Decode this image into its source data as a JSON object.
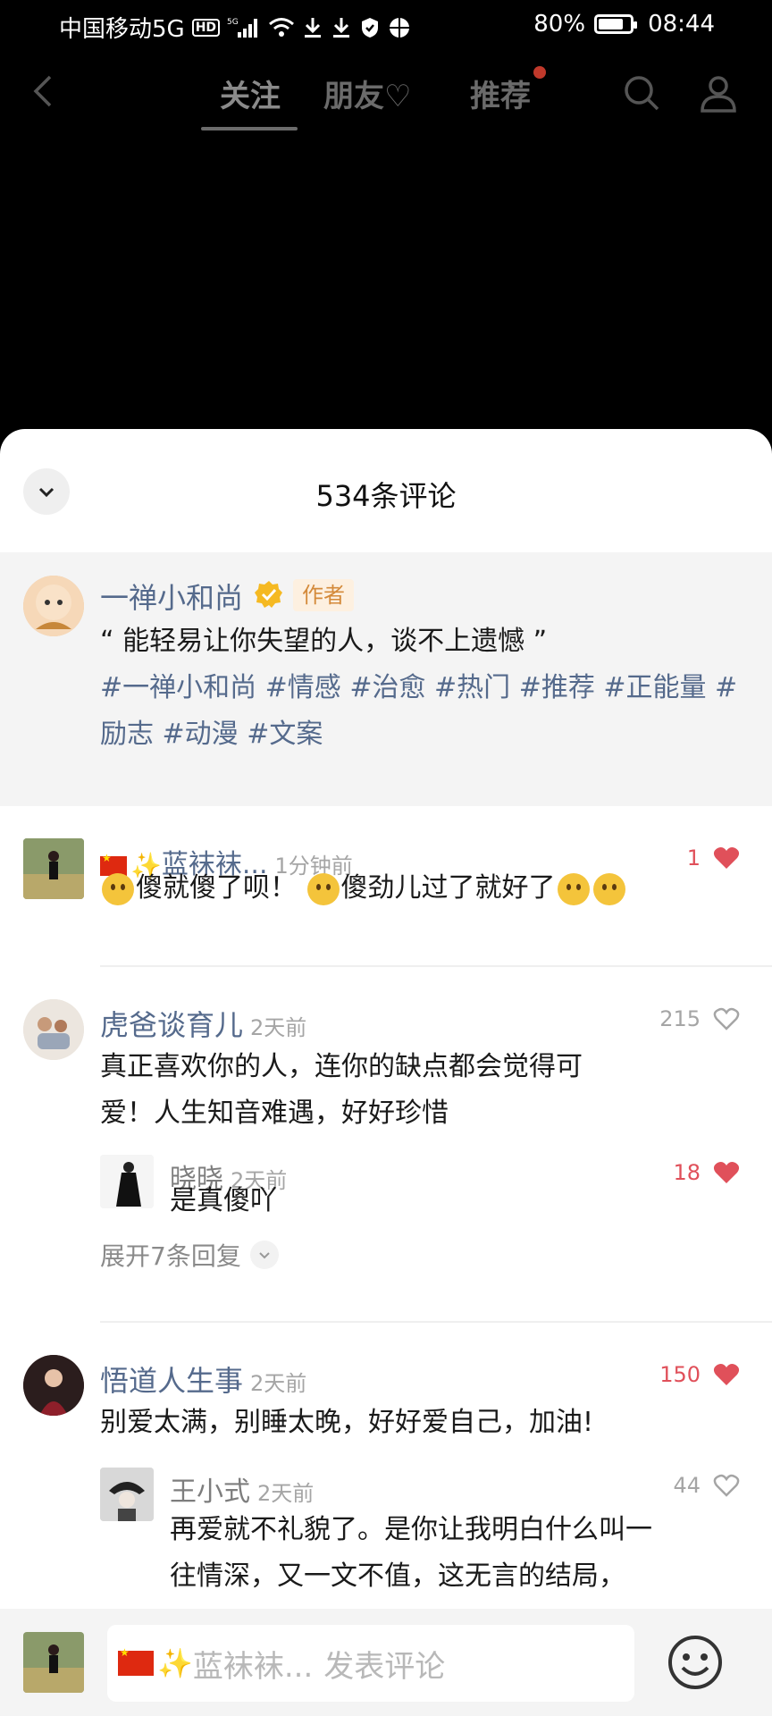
{
  "status_bar": {
    "carrier": "中国移动5G",
    "hd": "HD",
    "network": "5G",
    "battery": "80%",
    "battery_level": 0.8,
    "time": "08:44"
  },
  "top_nav": {
    "tabs": [
      {
        "label": "关注"
      },
      {
        "label": "朋友♡"
      },
      {
        "label": "推荐"
      }
    ]
  },
  "comments_panel": {
    "title": "534条评论",
    "author_post": {
      "name": "一禅小和尚",
      "badge": "作者",
      "text": "“ 能轻易让你失望的人，谈不上遗憾 ”",
      "tags_line1": "#一禅小和尚 #情感 #治愈 #热门 #推荐 #正能量 #",
      "tags_line2": "励志 #动漫 #文案"
    },
    "comments": [
      {
        "name": "蓝袜袜...",
        "time": "1分钟前",
        "likes": "1",
        "text_part1": "傻就傻了呗！",
        "text_part2": "傻劲儿过了就好了"
      },
      {
        "name": "虎爸谈育儿",
        "time": "2天前",
        "likes": "215",
        "text_line1": "真正喜欢你的人，连你的缺点都会觉得可",
        "text_line2": "爱！人生知音难遇，好好珍惜",
        "reply": {
          "name": "晓晓",
          "time": "2天前",
          "likes": "18",
          "text": "是真傻吖"
        },
        "expand": "展开7条回复"
      },
      {
        "name": "悟道人生事",
        "time": "2天前",
        "likes": "150",
        "text": "别爱太满，别睡太晚，好好爱自己，加油!",
        "reply": {
          "name": "王小式",
          "time": "2天前",
          "likes": "44",
          "text_line1": "再爱就不礼貌了。是你让我明白什么叫一",
          "text_line2": "往情深，又一文不值，这无言的结局，"
        }
      }
    ],
    "input": {
      "name": "蓝袜袜...",
      "placeholder": "发表评论"
    }
  },
  "colors": {
    "link_blue": "#556a8c",
    "like_red": "#e0505a",
    "author_badge_bg": "#fdf0e0"
  }
}
